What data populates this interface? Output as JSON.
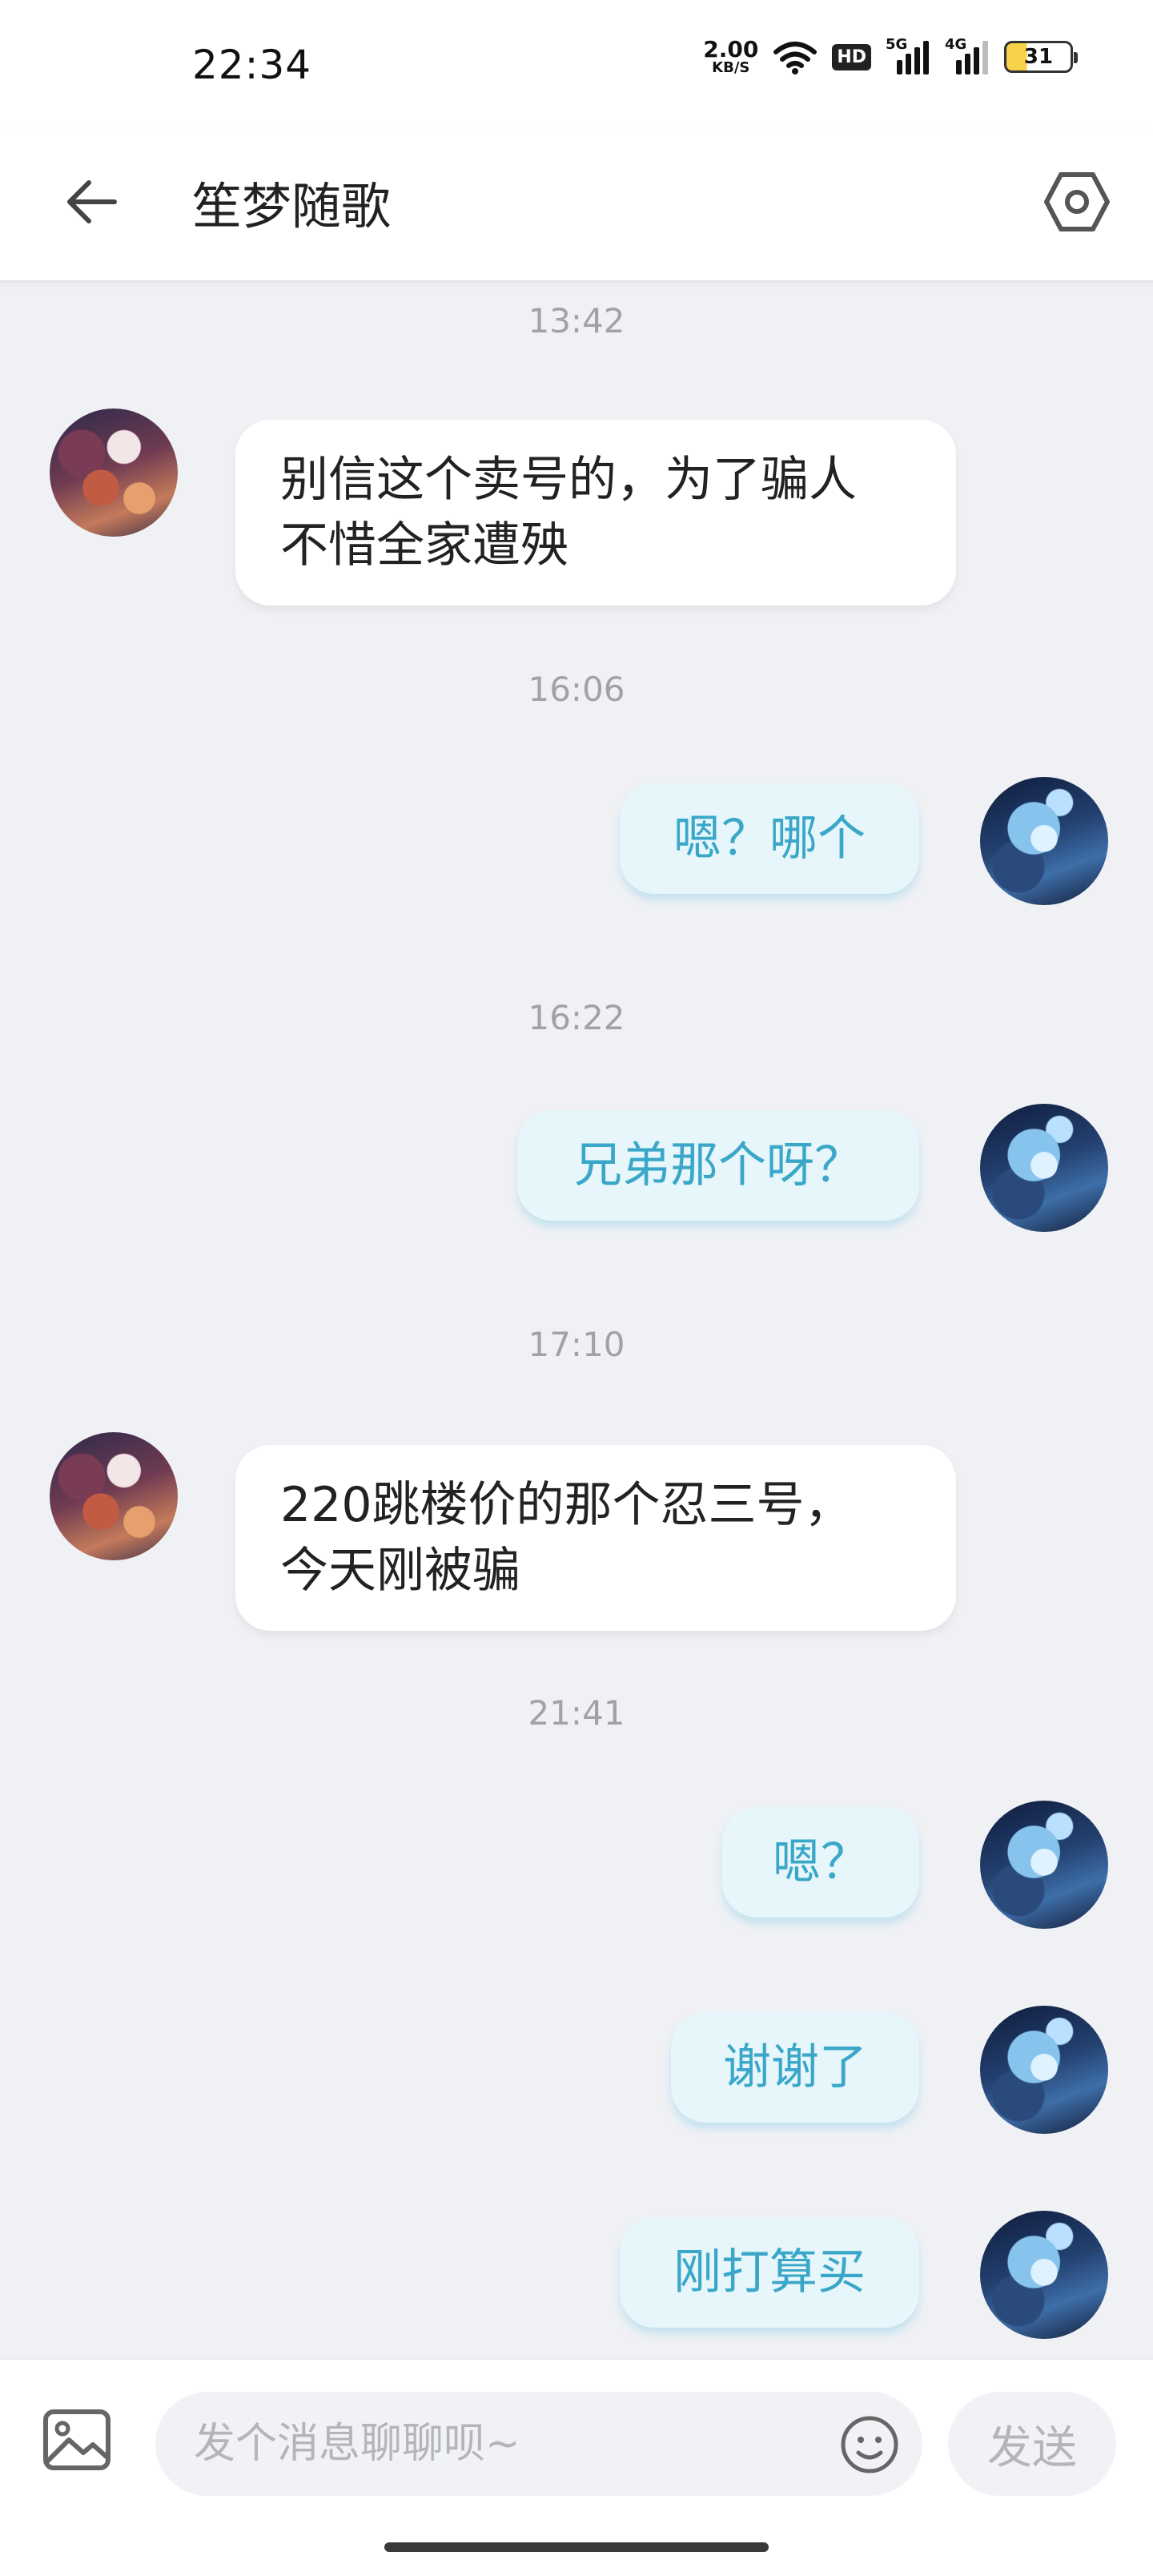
{
  "status_bar": {
    "time": "22:34",
    "net_speed_value": "2.00",
    "net_speed_unit": "KB/S",
    "hd_badge": "HD",
    "network_5g": "5G",
    "network_4g": "4G",
    "battery": "31"
  },
  "header": {
    "title": "笙梦随歌",
    "back_icon": "arrow-left-icon",
    "settings_icon": "hexagon-settings-icon"
  },
  "chat": {
    "timestamps": [
      "13:42",
      "16:06",
      "16:22",
      "17:10",
      "21:41"
    ],
    "messages": [
      {
        "sender": "other",
        "text": "别信这个卖号的，为了骗人\n不惜全家遭殃"
      },
      {
        "sender": "me",
        "text": "嗯？哪个"
      },
      {
        "sender": "me",
        "text": "兄弟那个呀？"
      },
      {
        "sender": "other",
        "text": "220跳楼价的那个忍三号，\n今天刚被骗"
      },
      {
        "sender": "me",
        "text": "嗯？"
      },
      {
        "sender": "me",
        "text": "谢谢了"
      },
      {
        "sender": "me",
        "text": "刚打算买"
      }
    ]
  },
  "input_bar": {
    "placeholder": "发个消息聊聊呗~",
    "send_label": "发送",
    "image_icon": "image-icon",
    "emoji_icon": "emoji-icon"
  },
  "colors": {
    "background": "#f0f1f5",
    "own_bubble_bg": "#e6f6fb",
    "own_bubble_text": "#3aa7c8",
    "other_bubble_bg": "#ffffff"
  }
}
